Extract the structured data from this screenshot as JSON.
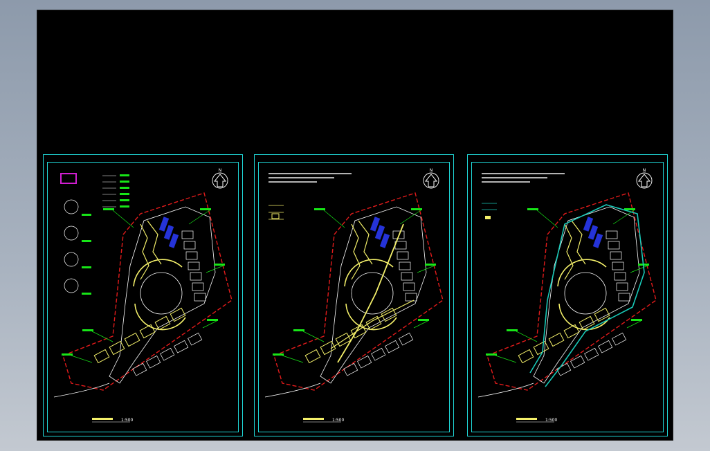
{
  "viewer": {
    "background_top": "#8d9aab",
    "background_bottom": "#c3c9d1",
    "model_space_color": "#000000"
  },
  "drawing_colors": {
    "frame": "#1fd8d8",
    "site_boundary": "#e21b1b",
    "building_lines": "#f4f06a",
    "annotation": "#17e617",
    "towers": "#2533d8",
    "pipe_lines": "#19c9b8",
    "highlight_box": "#d21ed2",
    "white_lines": "#ffffff"
  },
  "sheets": [
    {
      "id": "sheet-1",
      "north_label": "N",
      "scale_label": "1:500",
      "variant": "a"
    },
    {
      "id": "sheet-2",
      "north_label": "N",
      "scale_label": "1:500",
      "variant": "b"
    },
    {
      "id": "sheet-3",
      "north_label": "N",
      "scale_label": "1:500",
      "variant": "c"
    }
  ]
}
